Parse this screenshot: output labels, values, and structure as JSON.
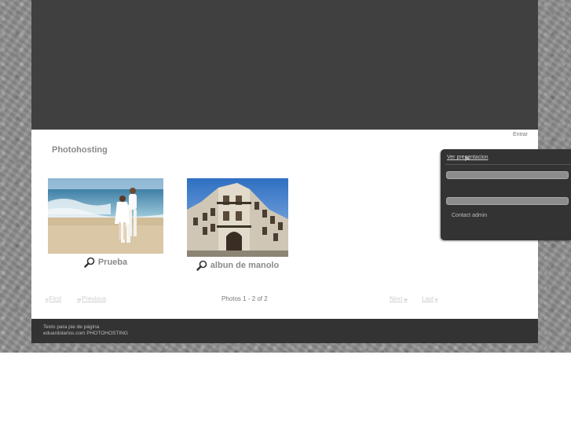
{
  "header": {
    "login_link": "Entrar"
  },
  "site": {
    "title": "Photohosting"
  },
  "albums": [
    {
      "title": "Prueba",
      "image": "beach-couple-photo",
      "icon": "magnifier-icon"
    },
    {
      "title": "albun de manolo",
      "image": "old-building-photo",
      "icon": "magnifier-icon"
    }
  ],
  "pager": {
    "first": "First",
    "previous": "Previous",
    "status": "Photos 1 - 2 of 2",
    "next": "Next",
    "last": "Last"
  },
  "footer": {
    "line1": "Texto para pie de página",
    "line2": "eduardolarios.com PHOTOHOSTING"
  },
  "panel": {
    "heading": "Ver presentacion",
    "field1_value": "",
    "field2_value": "",
    "contact_link": "Contact admin"
  },
  "colors": {
    "header": "#404040",
    "footer": "#333333",
    "panel": "#333333",
    "title_text": "#8a8a8a"
  }
}
